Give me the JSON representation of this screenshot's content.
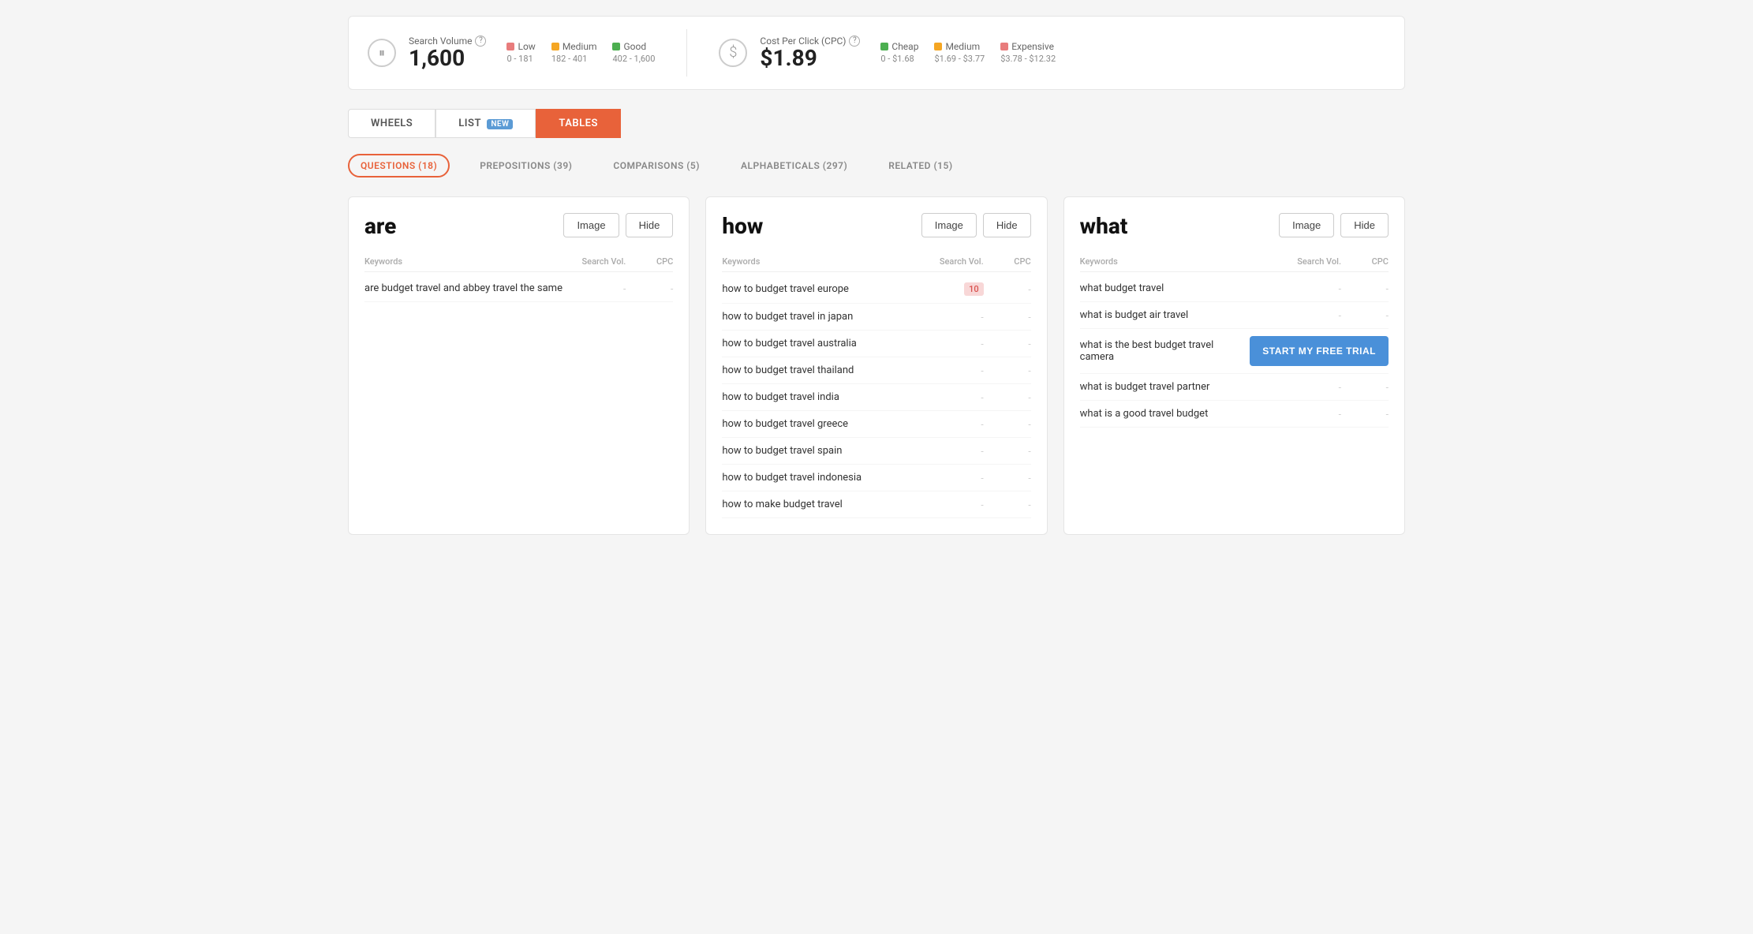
{
  "stats": {
    "searchVolume": {
      "icon": "⏸",
      "label": "Search Volume",
      "value": "1,600",
      "legend": [
        {
          "color": "#e87c7c",
          "label": "Low",
          "range": "0 - 181"
        },
        {
          "color": "#f5a623",
          "label": "Medium",
          "range": "182 - 401"
        },
        {
          "color": "#4caf50",
          "label": "Good",
          "range": "402 - 1,600"
        }
      ]
    },
    "cpc": {
      "icon": "$",
      "label": "Cost Per Click (CPC)",
      "value": "$1.89",
      "legend": [
        {
          "color": "#4caf50",
          "label": "Cheap",
          "range": "0 - $1.68"
        },
        {
          "color": "#f5a623",
          "label": "Medium",
          "range": "$1.69 - $3.77"
        },
        {
          "color": "#e87c7c",
          "label": "Expensive",
          "range": "$3.78 - $12.32"
        }
      ]
    }
  },
  "tabs": [
    {
      "id": "wheels",
      "label": "WHEELS",
      "active": false,
      "badge": null
    },
    {
      "id": "list",
      "label": "LIST",
      "active": false,
      "badge": "NEW"
    },
    {
      "id": "tables",
      "label": "TABLES",
      "active": true,
      "badge": null
    }
  ],
  "filterTabs": [
    {
      "id": "questions",
      "label": "QUESTIONS (18)",
      "active": true
    },
    {
      "id": "prepositions",
      "label": "PREPOSITIONS (39)",
      "active": false
    },
    {
      "id": "comparisons",
      "label": "COMPARISONS (5)",
      "active": false
    },
    {
      "id": "alphabeticals",
      "label": "ALPHABETICALS (297)",
      "active": false
    },
    {
      "id": "related",
      "label": "RELATED (15)",
      "active": false
    }
  ],
  "cards": [
    {
      "id": "are",
      "title": "are",
      "buttons": [
        "Image",
        "Hide"
      ],
      "columns": [
        "Keywords",
        "Search Vol.",
        "CPC"
      ],
      "keywords": [
        {
          "text": "are budget travel and abbey travel the same",
          "vol": "-",
          "cpc": "-",
          "volBadge": false,
          "ctaOverlay": false
        }
      ]
    },
    {
      "id": "how",
      "title": "how",
      "buttons": [
        "Image",
        "Hide"
      ],
      "columns": [
        "Keywords",
        "Search Vol.",
        "CPC"
      ],
      "keywords": [
        {
          "text": "how to budget travel europe",
          "vol": "10",
          "cpc": "-",
          "volBadge": true,
          "ctaOverlay": false
        },
        {
          "text": "how to budget travel in japan",
          "vol": "-",
          "cpc": "-",
          "volBadge": false,
          "ctaOverlay": false
        },
        {
          "text": "how to budget travel australia",
          "vol": "-",
          "cpc": "-",
          "volBadge": false,
          "ctaOverlay": false
        },
        {
          "text": "how to budget travel thailand",
          "vol": "-",
          "cpc": "-",
          "volBadge": false,
          "ctaOverlay": false
        },
        {
          "text": "how to budget travel india",
          "vol": "-",
          "cpc": "-",
          "volBadge": false,
          "ctaOverlay": false
        },
        {
          "text": "how to budget travel greece",
          "vol": "-",
          "cpc": "-",
          "volBadge": false,
          "ctaOverlay": false
        },
        {
          "text": "how to budget travel spain",
          "vol": "-",
          "cpc": "-",
          "volBadge": false,
          "ctaOverlay": false
        },
        {
          "text": "how to budget travel indonesia",
          "vol": "-",
          "cpc": "-",
          "volBadge": false,
          "ctaOverlay": false
        },
        {
          "text": "how to make budget travel",
          "vol": "-",
          "cpc": "-",
          "volBadge": false,
          "ctaOverlay": false
        }
      ]
    },
    {
      "id": "what",
      "title": "what",
      "buttons": [
        "Image",
        "Hide"
      ],
      "columns": [
        "Keywords",
        "Search Vol.",
        "CPC"
      ],
      "keywords": [
        {
          "text": "what budget travel",
          "vol": "-",
          "cpc": "-",
          "volBadge": false,
          "ctaOverlay": false
        },
        {
          "text": "what is budget air travel",
          "vol": "-",
          "cpc": "-",
          "volBadge": false,
          "ctaOverlay": false
        },
        {
          "text": "what is the best budget travel camera",
          "vol": "-",
          "cpc": "-",
          "volBadge": false,
          "ctaOverlay": true
        },
        {
          "text": "what is budget travel partner",
          "vol": "-",
          "cpc": "-",
          "volBadge": false,
          "ctaOverlay": false
        },
        {
          "text": "what is a good travel budget",
          "vol": "-",
          "cpc": "-",
          "volBadge": false,
          "ctaOverlay": false
        }
      ]
    }
  ],
  "cta": {
    "label": "START MY FREE TRIAL"
  }
}
